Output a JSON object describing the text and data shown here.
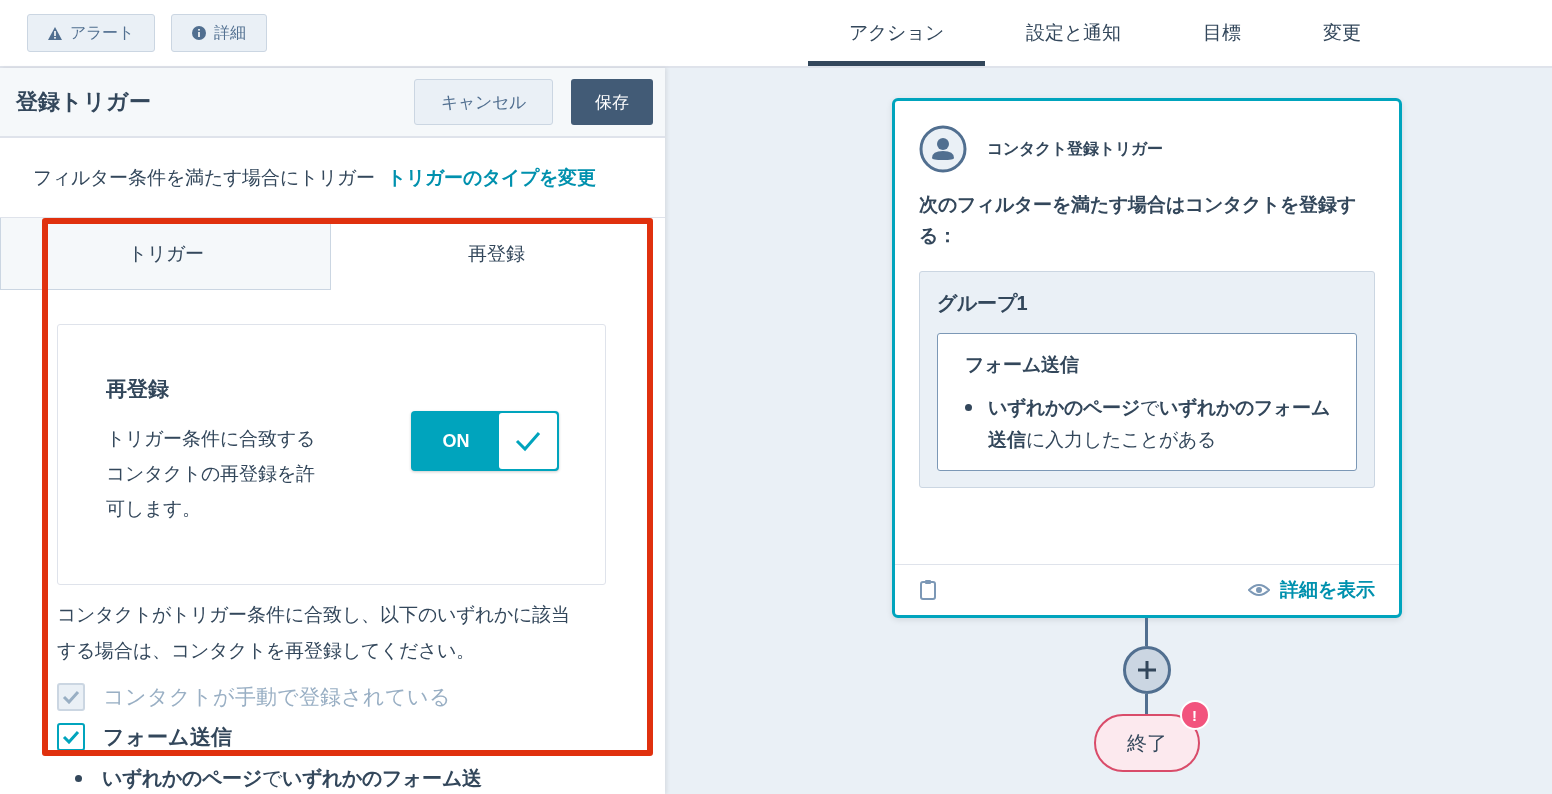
{
  "top_bar": {
    "buttons": [
      {
        "kind": "alert",
        "label": "アラート"
      },
      {
        "kind": "info",
        "label": "詳細"
      }
    ],
    "tabs": [
      {
        "label": "アクション",
        "selected": true
      },
      {
        "label": "設定と通知",
        "selected": false
      },
      {
        "label": "目標",
        "selected": false
      },
      {
        "label": "変更",
        "selected": false
      }
    ]
  },
  "panel": {
    "title": "登録トリガー",
    "cancel": "キャンセル",
    "save": "保存",
    "description": "フィルター条件を満たす場合にトリガー",
    "change_link": "トリガーのタイプを変更",
    "tabs": [
      {
        "label": "トリガー",
        "selected": false
      },
      {
        "label": "再登録",
        "selected": true
      }
    ],
    "reenroll": {
      "title": "再登録",
      "text": "トリガー条件に合致するコンタクトの再登録を許可します。",
      "toggle": {
        "label": "ON",
        "on": true
      }
    },
    "paragraph": "コンタクトがトリガー条件に合致し、以下のいずれかに該当する場合は、コンタクトを再登録してください。",
    "checkboxes": [
      {
        "label": "コンタクトが手動で登録されている",
        "checked": true,
        "disabled": true
      },
      {
        "label": "フォーム送信",
        "checked": true,
        "disabled": false
      }
    ],
    "bullet": "**いずれかのページ**で**いずれかのフォーム送**"
  },
  "canvas": {
    "card": {
      "title": "コンタクト登録トリガー",
      "text": "次のフィルターを満たす場合はコンタクトを登録する：",
      "group": {
        "title": "グループ1",
        "filter": {
          "title": "フォーム送信",
          "text": "**いずれかのページ**で**いずれかのフォーム送信**に入力したことがある"
        }
      },
      "details_link": "詳細を表示"
    },
    "end_node": {
      "label": "終了",
      "badge": "!"
    }
  }
}
